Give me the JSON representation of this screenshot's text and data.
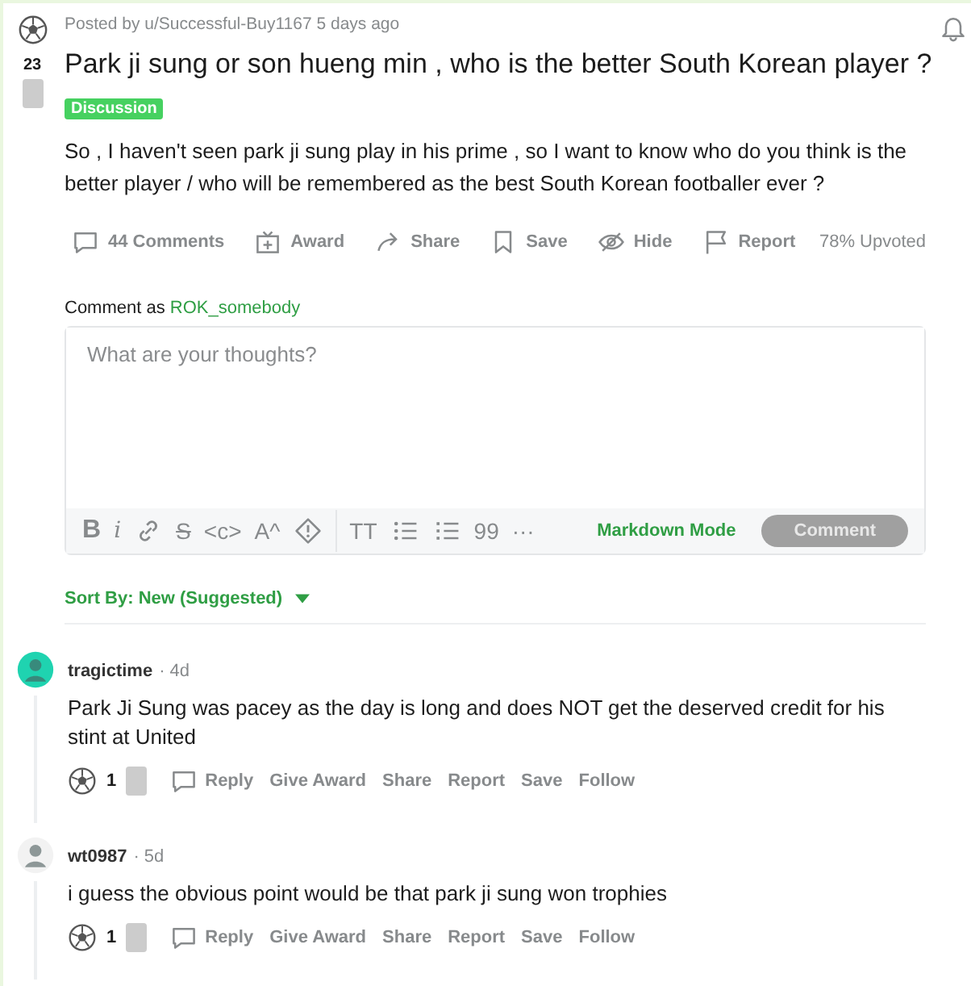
{
  "post": {
    "votes": "23",
    "meta": "Posted by u/Successful-Buy1167 5 days ago",
    "title": "Park ji sung or son hueng min , who is the better South Korean player ?",
    "flair": "Discussion",
    "body": "So , I haven't seen park ji sung play in his prime , so I want to know who do you think is the better player / who will be remembered as the best South Korean footballer ever ?",
    "actions": [
      {
        "kind": "comment",
        "label": "44 Comments"
      },
      {
        "kind": "award",
        "label": "Award"
      },
      {
        "kind": "share",
        "label": "Share"
      },
      {
        "kind": "save",
        "label": "Save"
      },
      {
        "kind": "hide",
        "label": "Hide"
      },
      {
        "kind": "report",
        "label": "Report"
      }
    ],
    "upvoted": "78% Upvoted"
  },
  "composer": {
    "prefix": "Comment as",
    "user": "ROK_somebody",
    "placeholder": "What are your thoughts?",
    "tools": [
      {
        "kind": "char",
        "text": "B"
      },
      {
        "kind": "italic",
        "text": "i"
      },
      {
        "kind": "link"
      },
      {
        "kind": "strike",
        "text": "S"
      },
      {
        "kind": "char",
        "text": "<c>"
      },
      {
        "kind": "char",
        "text": "A^"
      },
      {
        "kind": "spoiler"
      },
      {
        "kind": "heading",
        "text": "TT"
      },
      {
        "kind": "bullets"
      },
      {
        "kind": "numbers"
      },
      {
        "kind": "char",
        "text": "99"
      },
      {
        "kind": "char",
        "text": "···"
      }
    ],
    "mode": "Markdown Mode",
    "submit": "Comment"
  },
  "sort": "Sort By: New (Suggested)",
  "comments": [
    {
      "user": "tragictime",
      "age": "· 4d",
      "color": "#1fd3b0",
      "text": "Park Ji Sung was pacey as the day is long and does NOT get the deserved credit for his stint at United",
      "votes": "1",
      "actions": [
        "Reply",
        "Give Award",
        "Share",
        "Report",
        "Save",
        "Follow"
      ]
    },
    {
      "user": "wt0987",
      "age": "· 5d",
      "color": "#f2f2f2",
      "text": "i guess the obvious point would be that park ji sung won trophies",
      "votes": "1",
      "actions": [
        "Reply",
        "Give Award",
        "Share",
        "Report",
        "Save",
        "Follow"
      ]
    }
  ]
}
